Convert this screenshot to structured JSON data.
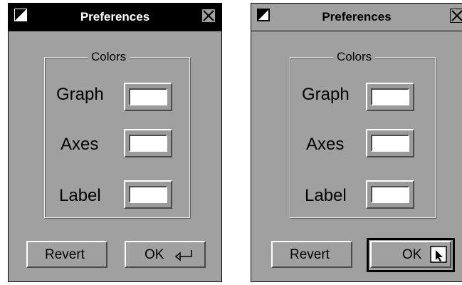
{
  "windows": [
    {
      "title": "Preferences",
      "state": "active",
      "group_title": "Colors",
      "rows": [
        {
          "label": "Graph",
          "color": "#ffffff"
        },
        {
          "label": "Axes",
          "color": "#ffffff"
        },
        {
          "label": "Label",
          "color": "#ffffff"
        }
      ],
      "buttons": {
        "revert": "Revert",
        "ok": "OK"
      }
    },
    {
      "title": "Preferences",
      "state": "inactive",
      "group_title": "Colors",
      "rows": [
        {
          "label": "Graph",
          "color": "#ffffff"
        },
        {
          "label": "Axes",
          "color": "#ffffff"
        },
        {
          "label": "Label",
          "color": "#ffffff"
        }
      ],
      "buttons": {
        "revert": "Revert",
        "ok": "OK"
      }
    }
  ],
  "icons": {
    "menu": "window-menu-icon",
    "close": "close-icon",
    "return_key": "return-key-icon",
    "pointer": "arrow-pointer-icon"
  },
  "colors": {
    "window_bg": "#a0a0a0",
    "active_titlebar": "#000000",
    "swatch_white": "#ffffff"
  }
}
